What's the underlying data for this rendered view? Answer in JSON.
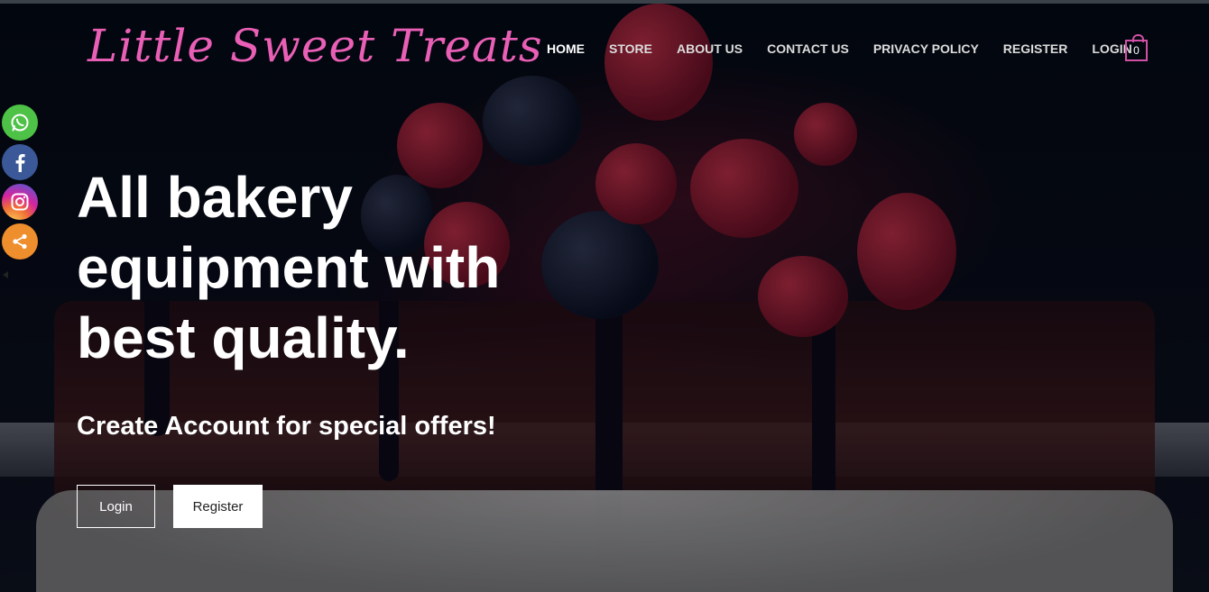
{
  "header": {
    "logo_text": "Little Sweet Treats",
    "cart_count": "0"
  },
  "nav": {
    "items": [
      {
        "label": "HOME",
        "active": true
      },
      {
        "label": "STORE"
      },
      {
        "label": "ABOUT US"
      },
      {
        "label": "CONTACT US"
      },
      {
        "label": "PRIVACY POLICY"
      },
      {
        "label": "REGISTER"
      },
      {
        "label": "LOGIN"
      }
    ]
  },
  "social": {
    "icons": [
      "whatsapp-icon",
      "facebook-icon",
      "instagram-icon",
      "share-icon"
    ]
  },
  "hero": {
    "headline": "All bakery equipment with best quality.",
    "subheadline": "Create Account for special offers!",
    "login_label": "Login",
    "register_label": "Register"
  },
  "colors": {
    "brand_pink": "#ea5fb6",
    "cart_border": "#d14fa4",
    "whatsapp": "#4dc247",
    "facebook": "#3b5998",
    "share": "#ee8e2c"
  }
}
